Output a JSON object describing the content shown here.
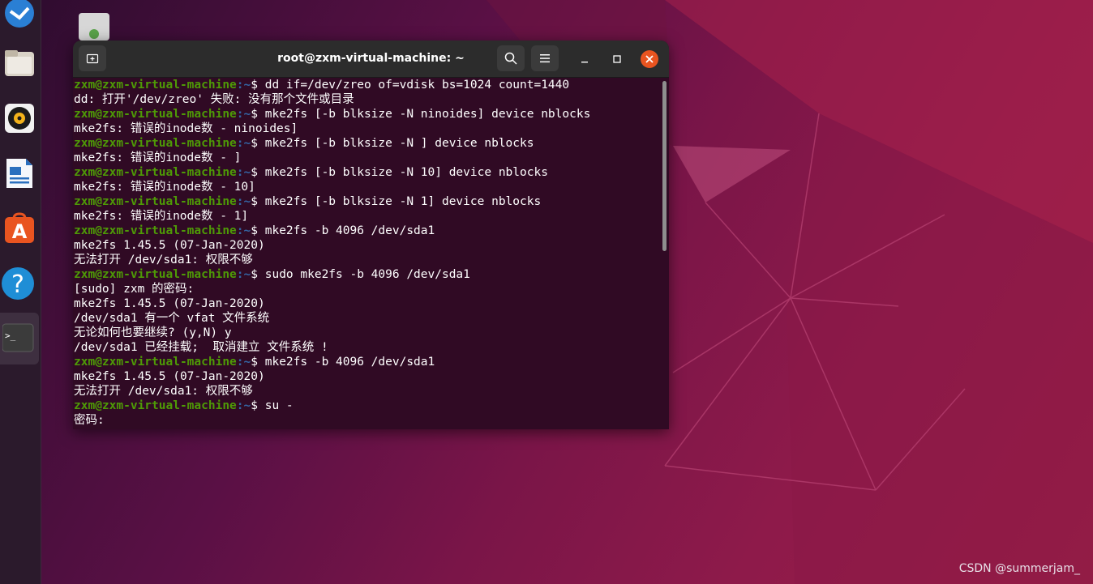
{
  "window": {
    "title": "root@zxm-virtual-machine: ~"
  },
  "prompt": {
    "user_host": "zxm@zxm-virtual-machine",
    "path": ":~",
    "symbol": "$ "
  },
  "terminal_lines": [
    {
      "type": "cmd",
      "text": "dd if=/dev/zreo of=vdisk bs=1024 count=1440"
    },
    {
      "type": "out",
      "text": "dd: 打开'/dev/zreo' 失败: 没有那个文件或目录"
    },
    {
      "type": "cmd",
      "text": "mke2fs [-b blksize -N ninoides] device nblocks"
    },
    {
      "type": "out",
      "text": "mke2fs: 错误的inode数 - ninoides]"
    },
    {
      "type": "cmd",
      "text": "mke2fs [-b blksize -N ] device nblocks"
    },
    {
      "type": "out",
      "text": "mke2fs: 错误的inode数 - ]"
    },
    {
      "type": "cmd",
      "text": "mke2fs [-b blksize -N 10] device nblocks"
    },
    {
      "type": "out",
      "text": "mke2fs: 错误的inode数 - 10]"
    },
    {
      "type": "cmd",
      "text": "mke2fs [-b blksize -N 1] device nblocks"
    },
    {
      "type": "out",
      "text": "mke2fs: 错误的inode数 - 1]"
    },
    {
      "type": "cmd",
      "text": "mke2fs -b 4096 /dev/sda1"
    },
    {
      "type": "out",
      "text": "mke2fs 1.45.5 (07-Jan-2020)"
    },
    {
      "type": "out",
      "text": "无法打开 /dev/sda1: 权限不够"
    },
    {
      "type": "cmd",
      "text": "sudo mke2fs -b 4096 /dev/sda1"
    },
    {
      "type": "out",
      "text": "[sudo] zxm 的密码:"
    },
    {
      "type": "out",
      "text": "mke2fs 1.45.5 (07-Jan-2020)"
    },
    {
      "type": "out",
      "text": "/dev/sda1 有一个 vfat 文件系统"
    },
    {
      "type": "out",
      "text": "无论如何也要继续? (y,N) y"
    },
    {
      "type": "out",
      "text": "/dev/sda1 已经挂载;  取消建立 文件系统 !"
    },
    {
      "type": "cmd",
      "text": "mke2fs -b 4096 /dev/sda1"
    },
    {
      "type": "out",
      "text": "mke2fs 1.45.5 (07-Jan-2020)"
    },
    {
      "type": "out",
      "text": "无法打开 /dev/sda1: 权限不够"
    },
    {
      "type": "cmd",
      "text": "su -"
    },
    {
      "type": "out",
      "text": "密码:"
    }
  ],
  "dock_items": [
    {
      "icon": "thunderbird-icon"
    },
    {
      "icon": "files-icon"
    },
    {
      "icon": "rhythmbox-icon"
    },
    {
      "icon": "libreoffice-writer-icon"
    },
    {
      "icon": "software-center-icon"
    },
    {
      "icon": "help-icon"
    },
    {
      "icon": "terminal-icon"
    }
  ],
  "watermark": "CSDN @summerjam_",
  "colors": {
    "terminal_bg": "#300a24",
    "prompt_user": "#4e9a06",
    "prompt_path": "#3465a4",
    "close_button": "#e95420"
  }
}
